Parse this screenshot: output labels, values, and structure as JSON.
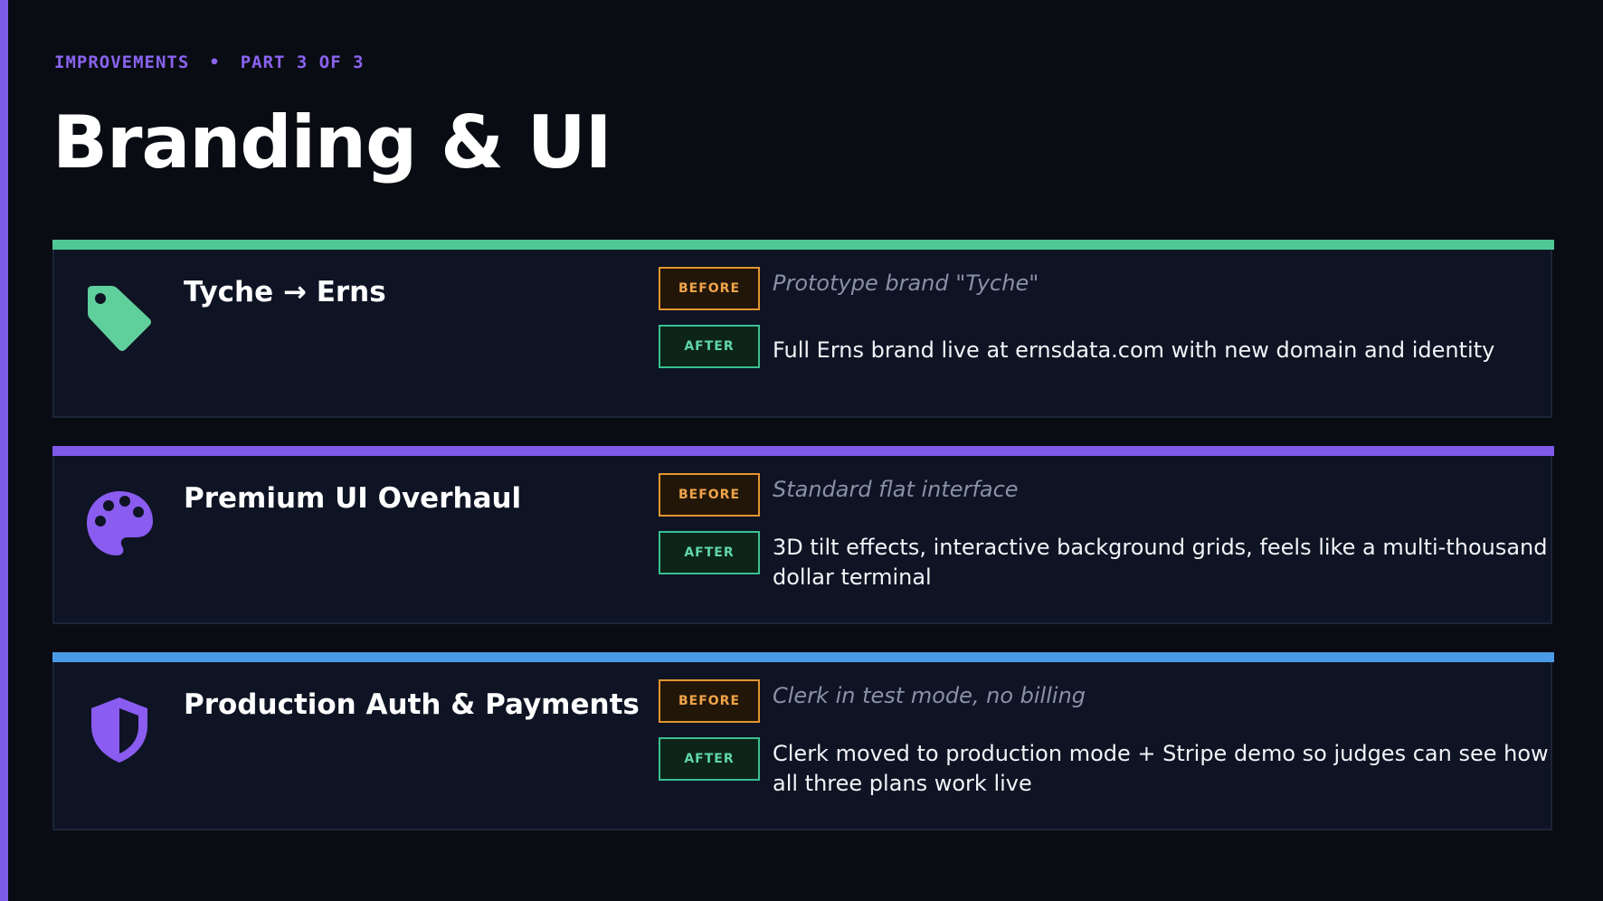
{
  "header": {
    "eyebrow_section": "IMPROVEMENTS",
    "eyebrow_separator": "•",
    "eyebrow_part": "PART 3 OF 3",
    "title": "Branding & UI"
  },
  "colors": {
    "background": "#0a0c13",
    "left_bar": "#7c5ce6",
    "eyebrow": "#8a63f0",
    "card_background": "#0e1424",
    "before_accent": "#e49530",
    "after_accent": "#3ac092"
  },
  "cards": [
    {
      "title": "Tyche → Erns",
      "icon": "tag-icon",
      "icon_color": "#5fcf9c",
      "accent_color": "#4fc894",
      "before_label": "BEFORE",
      "before_text": "Prototype brand \"Tyche\"",
      "after_label": "AFTER",
      "after_text": "Full Erns brand live at ernsdata.com with new domain and identity"
    },
    {
      "title": "Premium UI Overhaul",
      "icon": "palette-icon",
      "icon_color": "#8a5cf0",
      "accent_color": "#7f5ae8",
      "before_label": "BEFORE",
      "before_text": "Standard flat interface",
      "after_label": "AFTER",
      "after_text": "3D tilt effects, interactive background grids,  feels like a multi-thousand dollar terminal"
    },
    {
      "title": "Production Auth & Payments",
      "icon": "shield-icon",
      "icon_color": "#8a5cf0",
      "accent_color": "#4a9ae6",
      "before_label": "BEFORE",
      "before_text": "Clerk in test mode, no billing",
      "after_label": "AFTER",
      "after_text": "Clerk moved to production mode + Stripe demo so judges can see how all three plans work live"
    }
  ]
}
